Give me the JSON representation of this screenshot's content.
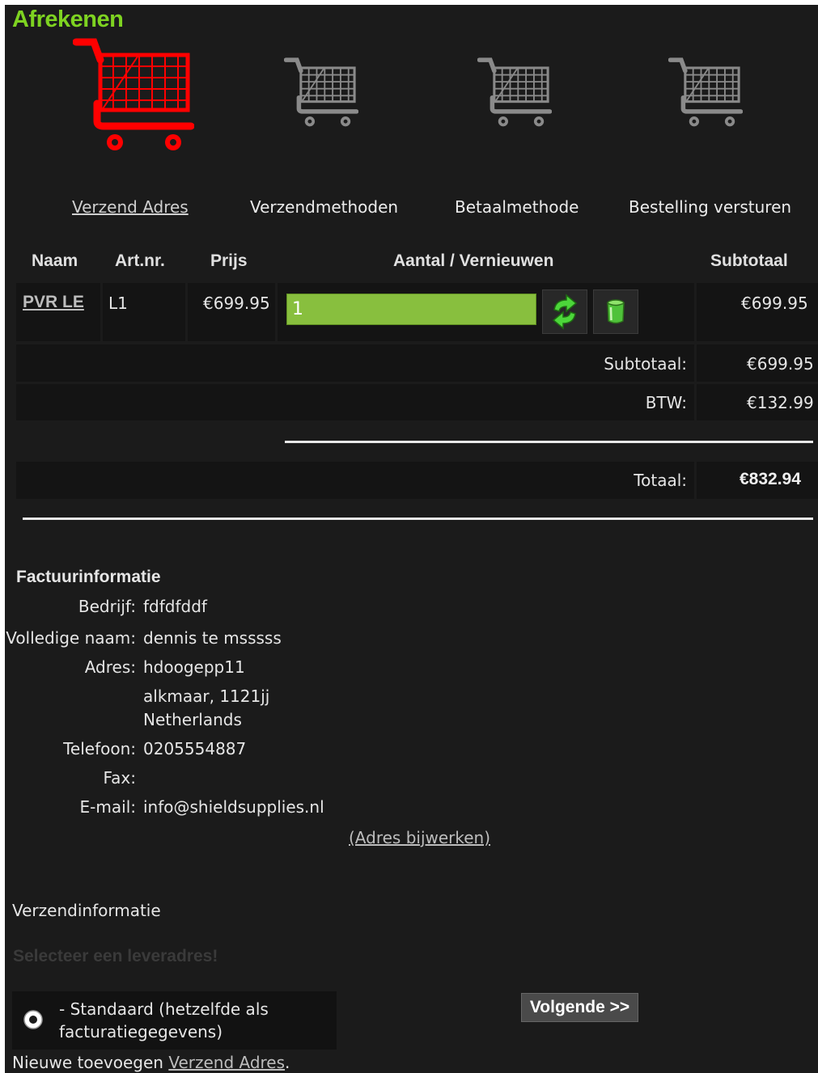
{
  "page": {
    "title": "Afrekenen"
  },
  "steps": [
    {
      "label": "Verzend Adres"
    },
    {
      "label": "Verzendmethoden"
    },
    {
      "label": "Betaalmethode"
    },
    {
      "label": "Bestelling versturen"
    }
  ],
  "table": {
    "headers": {
      "name": "Naam",
      "artnr": "Art.nr.",
      "price": "Prijs",
      "qty": "Aantal / Vernieuwen",
      "subtotal": "Subtotaal"
    },
    "rows": [
      {
        "name": "PVR LE",
        "artnr": "L1",
        "price": "€699.95",
        "qty": "1",
        "subtotal": "€699.95"
      }
    ]
  },
  "totals": {
    "subtotal_label": "Subtotaal:",
    "subtotal_value": "€699.95",
    "vat_label": "BTW:",
    "vat_value": "€132.99",
    "total_label": "Totaal:",
    "total_value": "€832.94"
  },
  "billing": {
    "heading": "Factuurinformatie",
    "company_label": "Bedrijf:",
    "company": "fdfdfddf",
    "name_label": "Volledige naam:",
    "name": "dennis te msssss",
    "address_label": "Adres:",
    "address_line1": "hdoogepp11",
    "address_line2": "alkmaar, 1121jj",
    "address_line3": "Netherlands",
    "phone_label": "Telefoon:",
    "phone": "0205554887",
    "fax_label": "Fax:",
    "fax": "",
    "email_label": "E-mail:",
    "email": "info@shieldsupplies.nl",
    "update_link": "(Adres bijwerken)"
  },
  "shipping": {
    "heading": "Verzendinformatie",
    "select_prompt": "Selecteer een leveradres!",
    "option_line1": "- Standaard (hetzelfde als",
    "option_line2": "facturatiegegevens)",
    "new_prefix": "Nieuwe toevoegen ",
    "new_link": "Verzend Adres",
    "new_suffix": ".",
    "next_button": "Volgende >>"
  },
  "colors": {
    "accent_green": "#7ed321",
    "active_cart": "#ff0000",
    "inactive_cart": "#8a8a8a",
    "qty_field": "#88bf3e"
  }
}
